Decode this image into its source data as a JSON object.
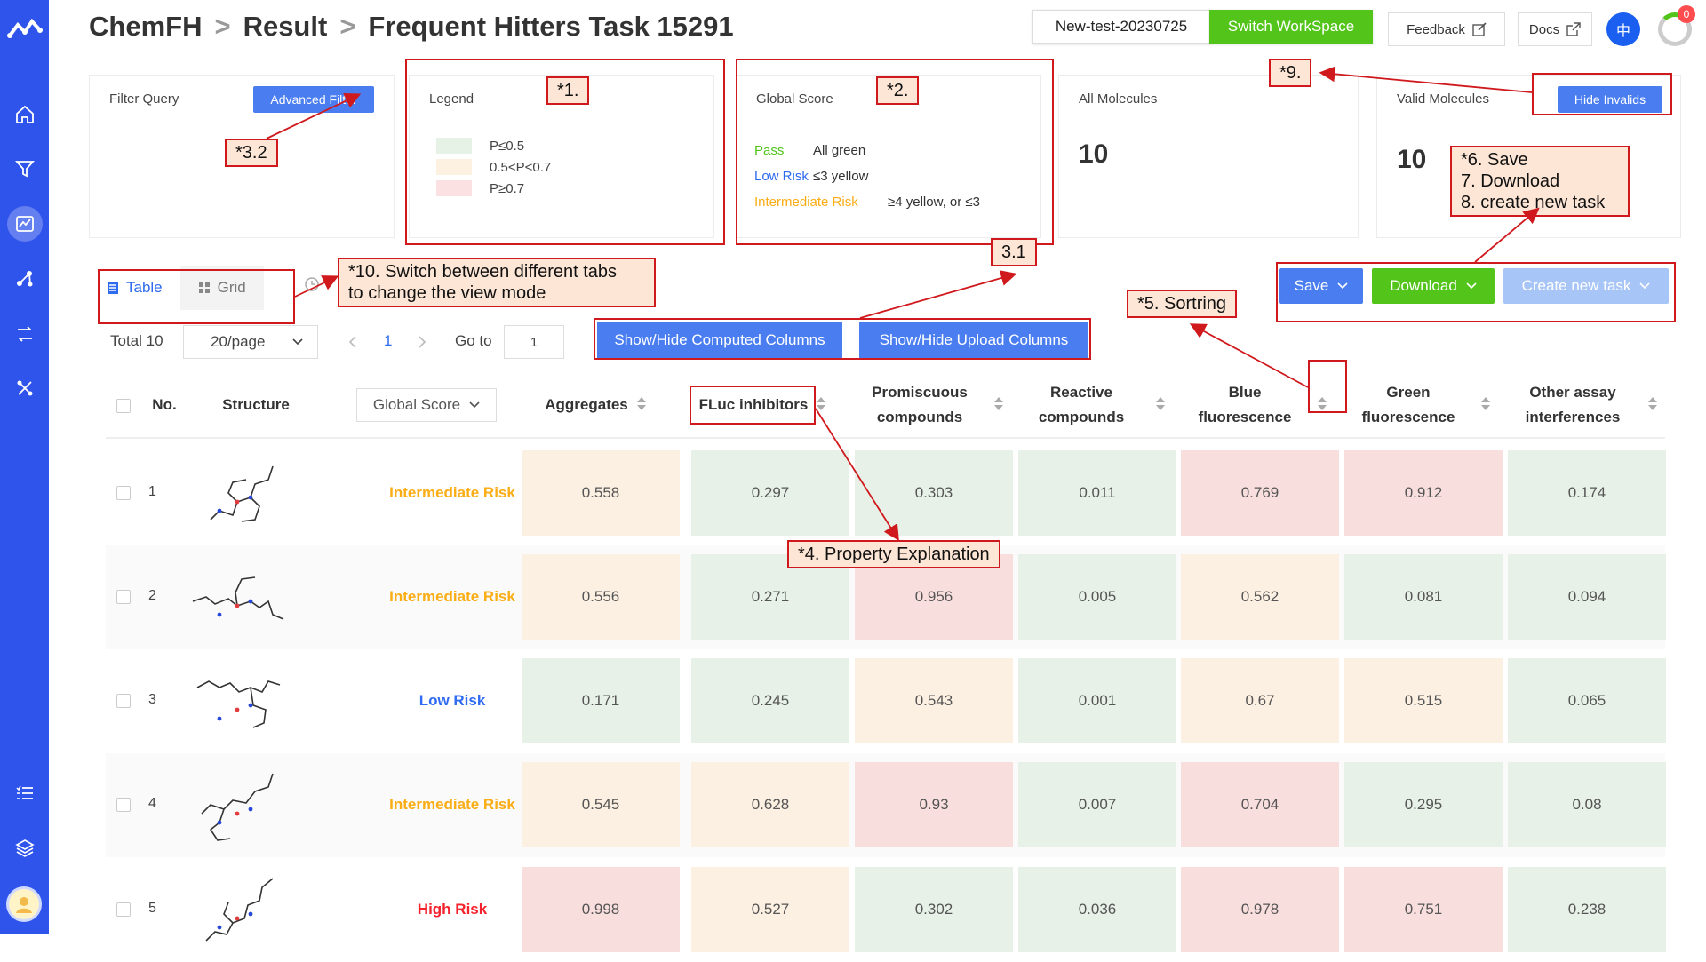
{
  "header": {
    "crumb1": "ChemFH",
    "sep": ">",
    "crumb2": "Result",
    "crumb3": "Frequent Hitters Task 15291",
    "workspace_name": "New-test-20230725",
    "switch_workspace": "Switch WorkSpace",
    "feedback": "Feedback",
    "docs": "Docs",
    "lang": "中",
    "notification_count": "0"
  },
  "cards": {
    "filter": {
      "title": "Filter Query",
      "button": "Advanced Filter"
    },
    "legend": {
      "title": "Legend",
      "items": [
        {
          "label": "P≤0.5",
          "color": "#e6f2e6"
        },
        {
          "label": "0.5<P<0.7",
          "color": "#fdf1e2"
        },
        {
          "label": "P≥0.7",
          "color": "#fbe1e1"
        }
      ]
    },
    "global_score": {
      "title": "Global Score",
      "rows": [
        {
          "key": "Pass",
          "desc": "All green",
          "color": "#52c41a"
        },
        {
          "key": "Low Risk",
          "desc": "≤3 yellow",
          "color": "#2f6bf0"
        },
        {
          "key": "Intermediate Risk",
          "desc": "≥4 yellow, or ≤3",
          "color": "#faad14"
        }
      ]
    },
    "all_molecules": {
      "title": "All Molecules",
      "value": "10"
    },
    "valid_molecules": {
      "title": "Valid Molecules",
      "value": "10",
      "button": "Hide Invalids"
    }
  },
  "toolbar": {
    "tab_table": "Table",
    "tab_grid": "Grid",
    "total": "Total 10",
    "page_size": "20/page",
    "current_page": "1",
    "goto_label": "Go to",
    "goto_value": "1",
    "computed_cols": "Show/Hide Computed Columns",
    "upload_cols": "Show/Hide Upload Columns",
    "save": "Save",
    "download": "Download",
    "create_task": "Create new task"
  },
  "table": {
    "headers": {
      "no": "No.",
      "structure": "Structure",
      "global_score": "Global Score",
      "aggregates": "Aggregates",
      "fluc": "FLuc inhibitors",
      "promiscuous_1": "Promiscuous",
      "promiscuous_2": "compounds",
      "reactive_1": "Reactive",
      "reactive_2": "compounds",
      "blue_1": "Blue",
      "blue_2": "fluorescence",
      "green_1": "Green",
      "green_2": "fluorescence",
      "other_1": "Other assay",
      "other_2": "interferences"
    },
    "rows": [
      {
        "no": "1",
        "risk": "Intermediate Risk",
        "risk_color": "#faad14",
        "values": [
          "0.558",
          "0.297",
          "0.303",
          "0.011",
          "0.769",
          "0.912",
          "0.174"
        ]
      },
      {
        "no": "2",
        "risk": "Intermediate Risk",
        "risk_color": "#faad14",
        "values": [
          "0.556",
          "0.271",
          "0.956",
          "0.005",
          "0.562",
          "0.081",
          "0.094"
        ]
      },
      {
        "no": "3",
        "risk": "Low Risk",
        "risk_color": "#2f6bf0",
        "values": [
          "0.171",
          "0.245",
          "0.543",
          "0.001",
          "0.67",
          "0.515",
          "0.065"
        ]
      },
      {
        "no": "4",
        "risk": "Intermediate Risk",
        "risk_color": "#faad14",
        "values": [
          "0.545",
          "0.628",
          "0.93",
          "0.007",
          "0.704",
          "0.295",
          "0.08"
        ]
      },
      {
        "no": "5",
        "risk": "High Risk",
        "risk_color": "#f5222d",
        "values": [
          "0.998",
          "0.527",
          "0.302",
          "0.036",
          "0.978",
          "0.751",
          "0.238"
        ]
      }
    ]
  },
  "annotations": {
    "a1": "*1.",
    "a2": "*2.",
    "a32": "*3.2",
    "a31": "3.1",
    "a4": "*4. Property Explanation",
    "a5": "*5. Sortring",
    "a6": "*6. Save\n7. Download\n8. create new task",
    "a9": "*9.",
    "a10": "*10. Switch between different tabs\nto change the view mode"
  }
}
